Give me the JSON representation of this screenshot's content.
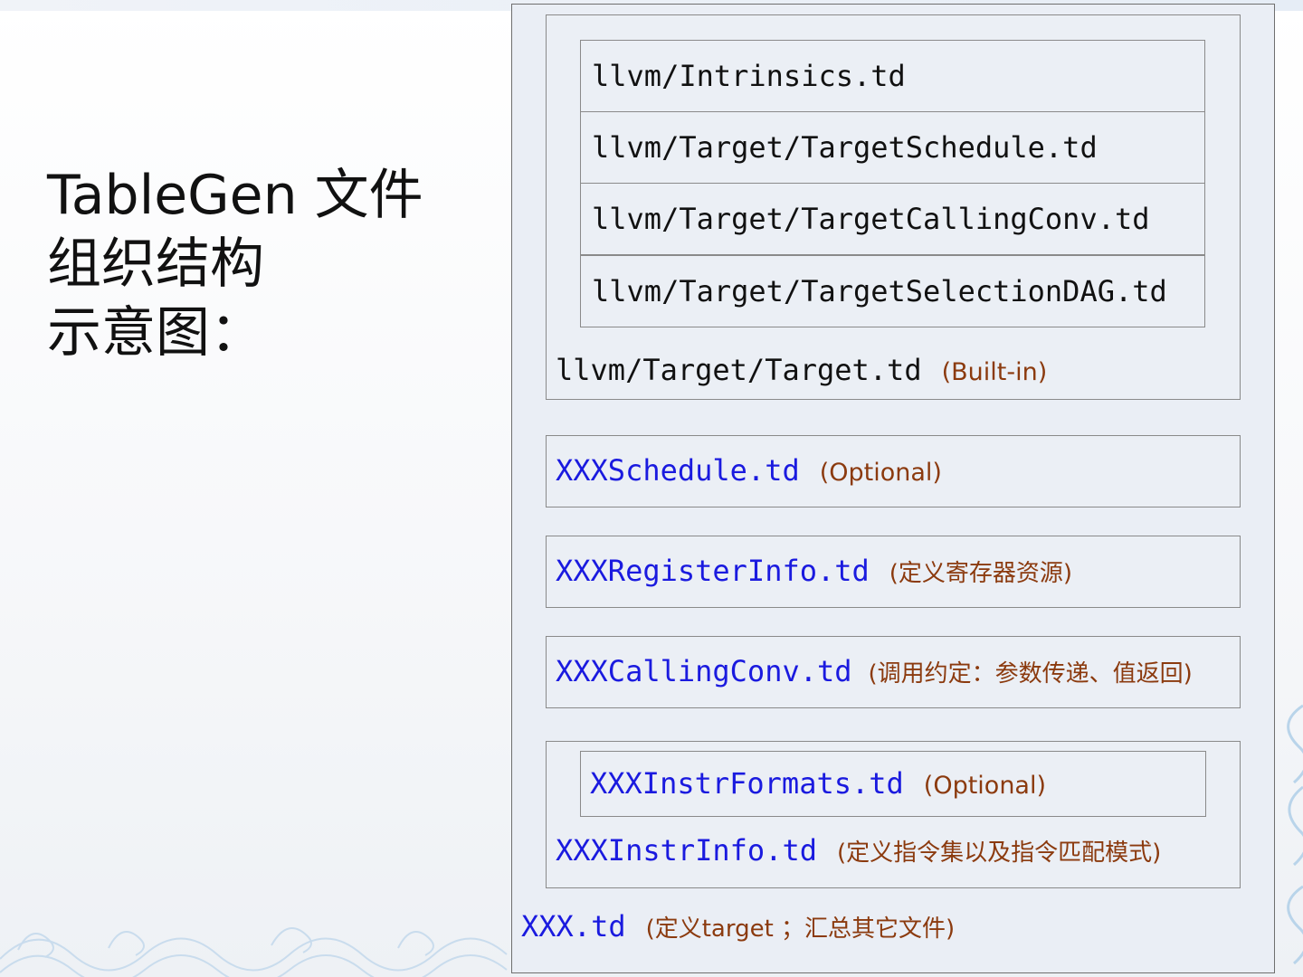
{
  "slide": {
    "title_lines": [
      "TableGen 文件",
      "组织结构",
      "示意图："
    ]
  },
  "diagram": {
    "target_group": {
      "inner_files": [
        "llvm/Intrinsics.td",
        "llvm/Target/TargetSchedule.td",
        "llvm/Target/TargetCallingConv.td",
        "llvm/Target/TargetSelectionDAG.td"
      ],
      "file": "llvm/Target/Target.td",
      "note": "(Built-in)"
    },
    "schedule": {
      "file": "XXXSchedule.td",
      "note": "(Optional)"
    },
    "register_info": {
      "file": "XXXRegisterInfo.td",
      "note": "(定义寄存器资源)"
    },
    "calling_conv": {
      "file": "XXXCallingConv.td",
      "note": "(调用约定：参数传递、值返回)"
    },
    "instr_group": {
      "inner_file": "XXXInstrFormats.td",
      "inner_note": "(Optional)",
      "file": "XXXInstrInfo.td",
      "note": "(定义指令集以及指令匹配模式)"
    },
    "root": {
      "file": "XXX.td",
      "note": "(定义target ；汇总其它文件)"
    },
    "colors": {
      "path_text": "#111111",
      "target_file_text": "#1a1adf",
      "note_text": "#8b3a0e",
      "box_fill": "#ebeff5",
      "box_border": "#8a8a8a"
    }
  }
}
